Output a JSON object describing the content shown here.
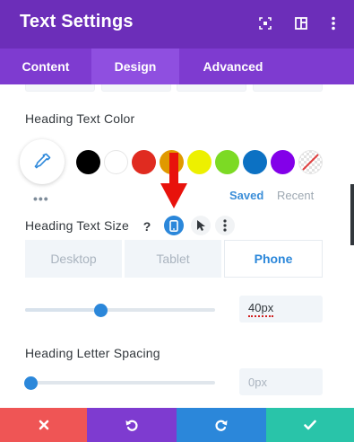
{
  "header": {
    "title": "Text Settings",
    "icons": [
      "expand-icon",
      "split-view-icon",
      "more-vertical-icon"
    ],
    "bg_color": "#6c2eb9"
  },
  "tabs": [
    {
      "label": "Content",
      "active": false
    },
    {
      "label": "Design",
      "active": true
    },
    {
      "label": "Advanced",
      "active": false
    }
  ],
  "heading_text_color": {
    "label": "Heading Text Color",
    "swatches": [
      "#000000",
      "#ffffff",
      "#e02b20",
      "#e09900",
      "#edf000",
      "#7cda24",
      "#0c71c3",
      "#8300e9",
      "transparent"
    ],
    "saved_label": "Saved",
    "recent_label": "Recent",
    "more": "•••"
  },
  "heading_text_size": {
    "label": "Heading Text Size",
    "help": "?",
    "devices": [
      {
        "label": "Desktop",
        "active": false
      },
      {
        "label": "Tablet",
        "active": false
      },
      {
        "label": "Phone",
        "active": true
      }
    ],
    "value": "40px"
  },
  "heading_letter_spacing": {
    "label": "Heading Letter Spacing",
    "value": "0px"
  },
  "footer": {
    "buttons": [
      {
        "icon": "close-icon",
        "color": "#ef5555"
      },
      {
        "icon": "undo-icon",
        "color": "#7e3bd0"
      },
      {
        "icon": "redo-icon",
        "color": "#2b87da"
      },
      {
        "icon": "check-icon",
        "color": "#29c4a9"
      }
    ]
  }
}
